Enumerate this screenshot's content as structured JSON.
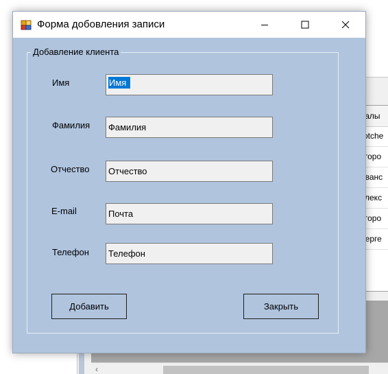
{
  "background_window": {
    "column_header": "малы",
    "rows": [
      "Jotche",
      "Егоро",
      "Иванс",
      "Алекс",
      "Егоро",
      "Серге"
    ]
  },
  "dialog": {
    "title": "Форма добовления записи",
    "group_title": "Добавление клиента",
    "fields": {
      "first_name": {
        "label": "Имя",
        "value": "Имя"
      },
      "last_name": {
        "label": "Фамилия",
        "value": "Фамилия"
      },
      "middle_name": {
        "label": "Отчество",
        "value": "Отчество"
      },
      "email": {
        "label": "E-mail",
        "value": "Почта"
      },
      "phone": {
        "label": "Телефон",
        "value": "Телефон"
      }
    },
    "buttons": {
      "add": "Добавить",
      "close": "Закрыть"
    }
  },
  "icons": {
    "app": "form-app-icon",
    "minimize": "minimize-icon",
    "maximize": "maximize-icon",
    "close": "close-icon"
  },
  "colors": {
    "dialog_background": "#b0c4de",
    "selection": "#0078d7",
    "input_background": "#f0f0f0"
  }
}
